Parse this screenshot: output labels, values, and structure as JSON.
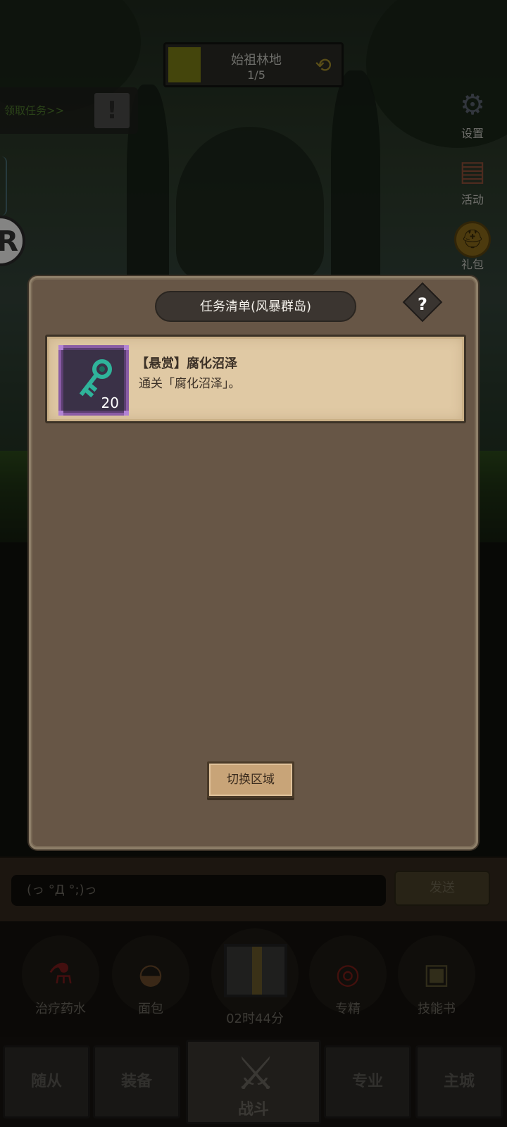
{
  "location": {
    "name": "始祖林地",
    "progress": "1/5"
  },
  "quest_tab": {
    "label": "领取任务>>",
    "alert": "!"
  },
  "side_menu": [
    {
      "label": "设置",
      "icon": "gear-icon"
    },
    {
      "label": "活动",
      "icon": "event-board-icon"
    },
    {
      "label": "礼包",
      "icon": "gift-pack-icon"
    }
  ],
  "modal": {
    "title": "任务清单(风暴群岛)",
    "help": "?",
    "quests": [
      {
        "title": "【悬赏】腐化沼泽",
        "desc": "通关「腐化沼泽」。",
        "reward_icon": "teal-key-icon",
        "reward_count": "20"
      }
    ],
    "switch_button": "切换区域"
  },
  "chat": {
    "placeholder": "(っ °Д °;)っ",
    "send": "发送"
  },
  "items": [
    {
      "label": "治疗药水",
      "icon": "healing-potion-icon"
    },
    {
      "label": "面包",
      "icon": "bread-icon"
    },
    {
      "label": "专精",
      "icon": "specialization-icon"
    },
    {
      "label": "技能书",
      "icon": "skill-book-icon"
    }
  ],
  "chest_timer": "02时44分",
  "nav": {
    "followers": "随从",
    "equipment": "装备",
    "battle": "战斗",
    "profession": "专业",
    "city": "主城"
  },
  "colors": {
    "modal_bg": "#675646",
    "card_bg": "#e0c9a4",
    "reward_frame": "#8a5ca5",
    "key": "#2fb39a"
  }
}
